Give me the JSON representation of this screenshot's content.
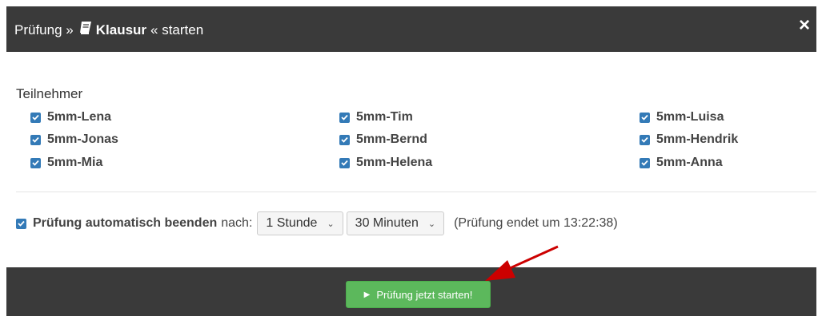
{
  "dialog": {
    "title_prefix": "Prüfung »",
    "title_exam": "Klausur",
    "title_suffix": "« starten",
    "close_symbol": "×"
  },
  "participants": {
    "label": "Teilnehmer",
    "items": [
      {
        "name": "5mm-Lena",
        "checked": true
      },
      {
        "name": "5mm-Jonas",
        "checked": true
      },
      {
        "name": "5mm-Mia",
        "checked": true
      },
      {
        "name": "5mm-Tim",
        "checked": true
      },
      {
        "name": "5mm-Bernd",
        "checked": true
      },
      {
        "name": "5mm-Helena",
        "checked": true
      },
      {
        "name": "5mm-Luisa",
        "checked": true
      },
      {
        "name": "5mm-Hendrik",
        "checked": true
      },
      {
        "name": "5mm-Anna",
        "checked": true
      }
    ]
  },
  "auto_end": {
    "checked": true,
    "label_bold": "Prüfung automatisch beenden",
    "label_after": "nach:",
    "hours_value": "1 Stunde",
    "minutes_value": "30 Minuten",
    "ends_text": "(Prüfung endet um 13:22:38)"
  },
  "footer": {
    "start_button_label": "Prüfung jetzt starten!"
  },
  "colors": {
    "header_bg": "#3a3a3a",
    "checkbox": "#337ab7",
    "start_button": "#5cb85c",
    "annotation_arrow": "#cc0000"
  }
}
